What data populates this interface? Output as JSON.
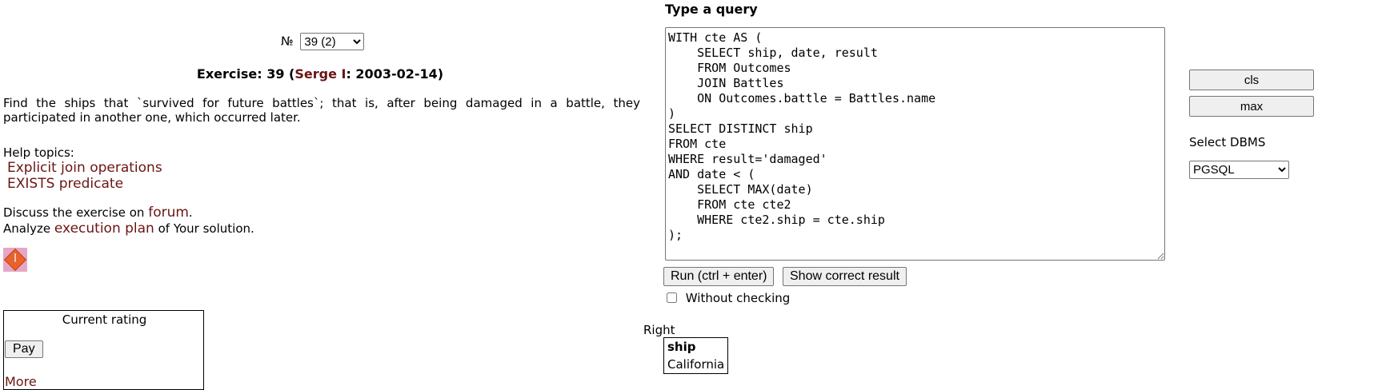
{
  "exercise": {
    "number_label": "№",
    "number_selected": "39 (2)",
    "title_prefix": "Exercise: 39 (",
    "author": "Serge I",
    "title_suffix": ": 2003-02-14)",
    "description": "Find the ships that `survived for future battles`; that is, after being damaged in a battle, they participated in another one, which occurred later."
  },
  "help": {
    "label": "Help topics:",
    "topics": [
      "Explicit join operations",
      "EXISTS predicate"
    ]
  },
  "discuss": {
    "prefix": "Discuss the exercise on ",
    "link": "forum",
    "suffix": "."
  },
  "analyze": {
    "prefix": "Analyze ",
    "link": "execution plan",
    "suffix": " of Your solution."
  },
  "rating": {
    "title": "Current rating",
    "pay_label": "Pay",
    "more_label": "More"
  },
  "query": {
    "title": "Type a query",
    "text": "WITH cte AS (\n    SELECT ship, date, result\n    FROM Outcomes\n    JOIN Battles\n    ON Outcomes.battle = Battles.name\n)\nSELECT DISTINCT ship\nFROM cte\nWHERE result='damaged'\nAND date < (\n    SELECT MAX(date)\n    FROM cte cte2\n    WHERE cte2.ship = cte.ship\n);",
    "run_label": "Run (ctrl + enter)",
    "show_label": "Show correct result",
    "without_checking_label": "Without checking",
    "without_checking_checked": false
  },
  "side": {
    "cls_label": "cls",
    "max_label": "max",
    "dbms_label": "Select DBMS",
    "dbms_selected": "PGSQL"
  },
  "result": {
    "status": "Right",
    "columns": [
      "ship"
    ],
    "rows": [
      [
        "California"
      ]
    ]
  },
  "colors": {
    "link": "#6b1414",
    "badge_bg": "#e6a6c8",
    "badge_fg": "#e8622c"
  }
}
